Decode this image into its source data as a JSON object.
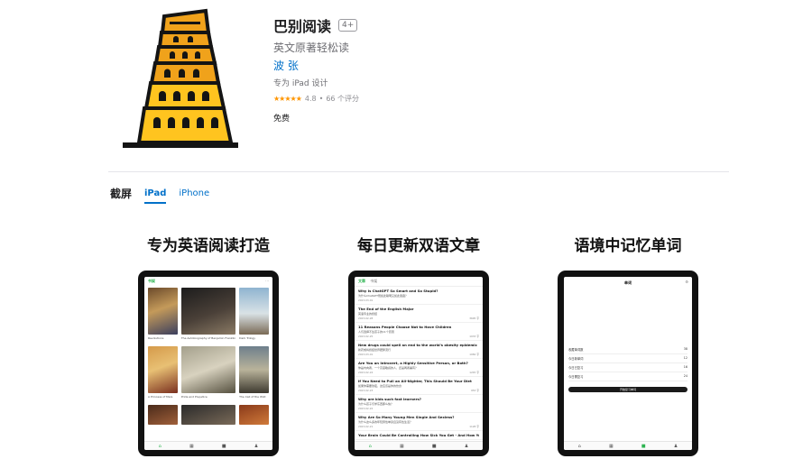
{
  "app": {
    "title": "巴别阅读",
    "age_rating": "4+",
    "subtitle": "英文原著轻松读",
    "developer": "波 张",
    "designed_for": "专为 iPad 设计",
    "stars": "★★★★★",
    "rating": "4.8",
    "rating_separator": "•",
    "rating_count": "66 个评分",
    "price": "免费"
  },
  "screenshots": {
    "section_title": "截屏",
    "tabs": [
      "iPad",
      "iPhone"
    ],
    "items": [
      {
        "caption": "专为英语阅读打造",
        "top_tab": "书架",
        "menu": "⋯",
        "covers": [
          {
            "title": "",
            "label": "Revolutions"
          },
          {
            "title": "",
            "label": "The Autobiography of Benjamin Franklin"
          },
          {
            "title": "",
            "label": "Dark Trilogy"
          },
          {
            "title": "",
            "label": "A Princess of Mars"
          },
          {
            "title": "",
            "label": "Pride and Prejudice"
          },
          {
            "title": "",
            "label": "The Call of the Wild"
          },
          {
            "title": "",
            "label": ""
          },
          {
            "title": "",
            "label": ""
          },
          {
            "title": "",
            "label": ""
          }
        ],
        "tabbar": [
          "⌂",
          "▦",
          "■",
          "♟"
        ]
      },
      {
        "caption": "每日更新双语文章",
        "top_tab_active": "文章",
        "top_tab_inactive": "书架",
        "articles": [
          {
            "title": "Why Is ChatGPT So Smart and So Stupid?",
            "sub": "为什么ChatGPT既如此聪明又如此愚蠢？",
            "date": "2023-03-01",
            "count": ""
          },
          {
            "title": "The End of the English Major",
            "sub": "英语专业的终结",
            "date": "2023-02-28",
            "count": "3695 字"
          },
          {
            "title": "11 Reasons People Choose Not to Have Children",
            "sub": "人们选择不生孩子的11个原因",
            "date": "2023-02-25",
            "count": "1033 字"
          },
          {
            "title": "New drugs could spell an end to the world's obesity epidemic",
            "sub": "新药或将终结世界肥胖流行",
            "date": "2023-03-01",
            "count": "1084 字"
          },
          {
            "title": "Are You an Introvert, a Highly Sensitive Person, or Both?",
            "sub": "你是内向者，一个高度敏感的人，还是两者兼有？",
            "date": "2023-02-24",
            "count": "1245 字"
          },
          {
            "title": "If You Need to Pull an All-Nighter, This Should Be Your Diet",
            "sub": "如果你需要熬夜，这应该是你的饮食",
            "date": "2023-02-23",
            "count": "953 字"
          },
          {
            "title": "Why are kids such fast learners?",
            "sub": "为什么孩子们学东西那么快？",
            "date": "2023-02-22",
            "count": ""
          },
          {
            "title": "Why Are So Many Young Men Single And Sexless?",
            "sub": "为什么这么多的年轻男性单身且没有性生活？",
            "date": "2023-02-21",
            "count": "1128 字"
          },
          {
            "title": "Your Brain Could Be Controlling How Sick You Get - And How You Recover",
            "sub": "",
            "date": "",
            "count": ""
          }
        ],
        "tabbar": [
          "⌂",
          "▦",
          "■",
          "♟"
        ]
      },
      {
        "caption": "语境中记忆单词",
        "screen_title": "单词",
        "corner": "⚙",
        "vocab_rows": [
          {
            "label": "收藏单词数",
            "value": "38"
          },
          {
            "label": "今日新单词",
            "value": "12"
          },
          {
            "label": "今日已复习",
            "value": "16"
          },
          {
            "label": "今日需复习",
            "value": "24"
          }
        ],
        "button": "开始复习单词",
        "tabbar": [
          "⌂",
          "▦",
          "■",
          "♟"
        ]
      }
    ]
  },
  "colors": {
    "link": "#0070c9",
    "star": "#ff9500",
    "accent_green": "#2db351",
    "icon_orange": "#f0a21b",
    "icon_yellow": "#ffc41f",
    "icon_dark": "#141414"
  },
  "icons": {
    "app_icon": "tower-of-babel-icon"
  }
}
